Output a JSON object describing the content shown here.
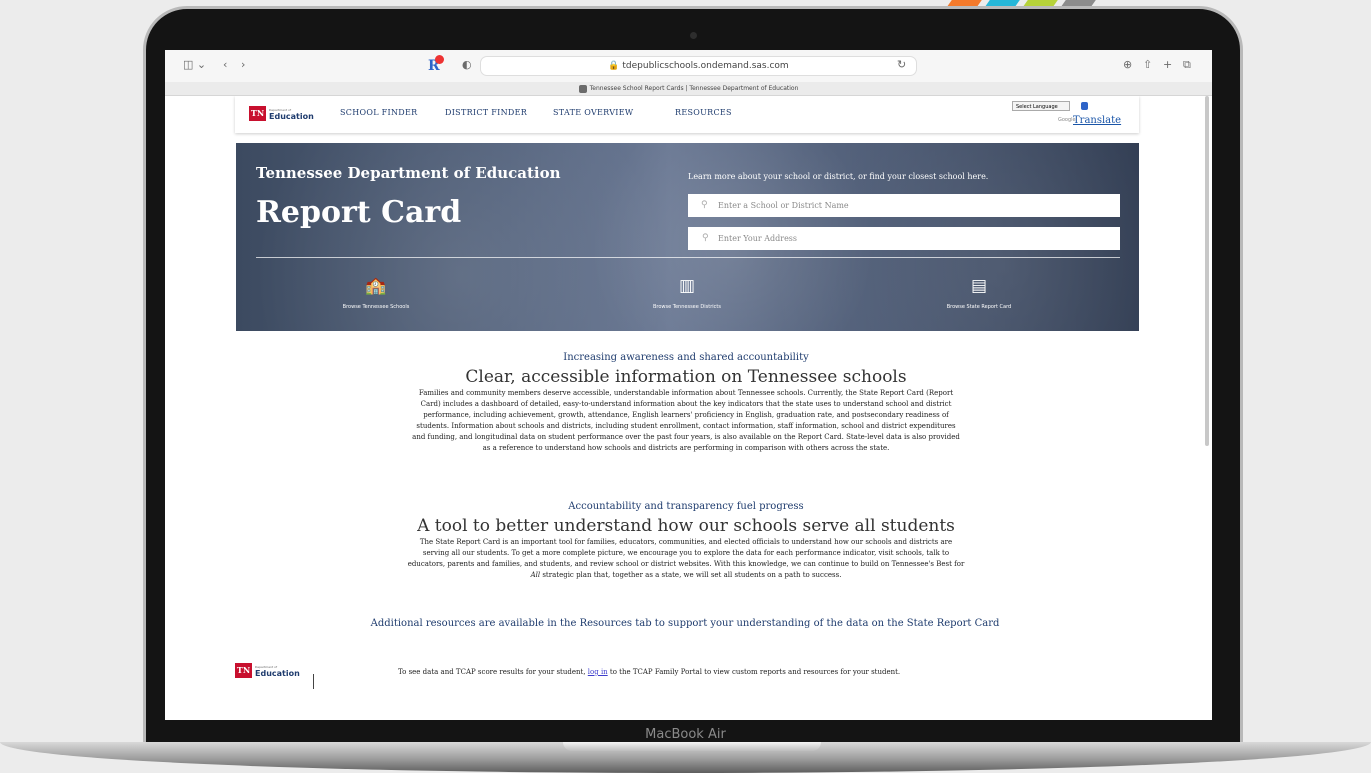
{
  "decor_colors": [
    "#f47a2b",
    "#27b7d8",
    "#b6d23a",
    "#8c8c8c"
  ],
  "device": {
    "model_label": "MacBook Air"
  },
  "browser": {
    "url": "tdepublicschools.ondemand.sas.com",
    "tab_title": "Tennessee School Report Cards | Tennessee Department of Education",
    "bookmark_colors": [
      "#d93a2b",
      "#2f6b3b"
    ]
  },
  "nav": {
    "logo": {
      "tn": "TN",
      "dept": "Department of",
      "education": "Education"
    },
    "links": [
      "SCHOOL FINDER",
      "DISTRICT FINDER",
      "STATE OVERVIEW",
      "RESOURCES"
    ],
    "language_select": "Select Language",
    "google_label": "Google",
    "translate": "Translate"
  },
  "hero": {
    "subtitle": "Tennessee Department of Education",
    "title": "Report Card",
    "prompt": "Learn more about your school or district, or find your closest school here.",
    "school_placeholder": "Enter a School or District Name",
    "address_placeholder": "Enter Your Address",
    "browse": [
      {
        "icon": "school-building-icon",
        "label": "Browse Tennessee Schools"
      },
      {
        "icon": "district-building-icon",
        "label": "Browse Tennessee Districts"
      },
      {
        "icon": "state-report-card-icon",
        "label": "Browse State Report Card"
      }
    ]
  },
  "section1": {
    "eyebrow": "Increasing awareness and shared accountability",
    "heading": "Clear, accessible information on Tennessee schools",
    "lines": [
      "Families and community members deserve accessible, understandable information about Tennessee schools. Currently, the State Report Card (Report",
      "Card) includes a dashboard of detailed, easy-to-understand information about the key indicators that the state uses to understand school and district",
      "performance, including achievement, growth, attendance, English learners' proficiency in English, graduation rate, and postsecondary readiness of",
      "students. Information about schools and districts, including student enrollment, contact information, staff information, school and district expenditures",
      "and funding, and longitudinal data on student performance over the past four years, is also available on the Report Card. State-level data is also provided",
      "as a reference to understand how schools and districts are performing in comparison with others across the state."
    ]
  },
  "section2": {
    "eyebrow": "Accountability and transparency fuel progress",
    "heading": "A tool to better understand how our schools serve all students",
    "lines": [
      "The State Report Card is an important tool for families, educators, communities, and elected officials to understand how our schools and districts are",
      "serving all our students. To get a more complete picture, we encourage you to explore the data for each performance indicator, visit schools, talk to",
      "educators, parents and families, and students, and review school or district websites. With this knowledge, we can continue to build on Tennessee's Best for"
    ],
    "last_line_italic": "All",
    "last_line_rest": " strategic plan that, together as a state, we will set all students on a path to success."
  },
  "resources_text": "Additional resources are available in the Resources tab to support your understanding of the data on the State Report Card",
  "footer": {
    "before": "To see data and TCAP score results for your student, ",
    "link": "log in",
    "after": " to the TCAP Family Portal to view custom reports and resources for your student."
  }
}
